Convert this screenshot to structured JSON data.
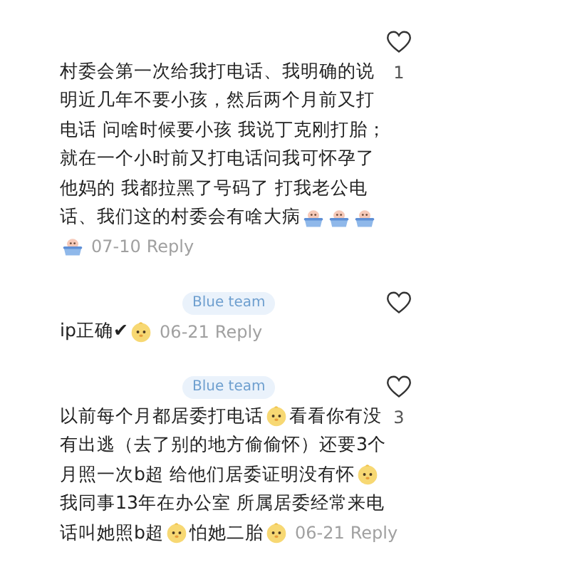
{
  "comments": [
    {
      "lines": [
        [
          {
            "kind": "text",
            "text": "村委会第一次给我打电话、我明确的说"
          }
        ],
        [
          {
            "kind": "text",
            "text": "明近几年不要小孩，然后两个月前又打"
          }
        ],
        [
          {
            "kind": "text",
            "text": "电话 问啥时候要小孩 我说丁克刚打胎；"
          }
        ],
        [
          {
            "kind": "text",
            "text": "就在一个小时前又打电话问我可怀孕了"
          }
        ],
        [
          {
            "kind": "text",
            "text": "他妈的 我都拉黑了号码了 打我老公电"
          }
        ],
        [
          {
            "kind": "text",
            "text": "话、我们这的村委会有啥大病"
          },
          {
            "kind": "tub"
          },
          {
            "kind": "tub"
          },
          {
            "kind": "tub"
          }
        ],
        [
          {
            "kind": "tub"
          }
        ]
      ],
      "date": "07-10",
      "reply": "Reply",
      "likes": "1"
    },
    {
      "tag": "Blue team",
      "lines": [
        [
          {
            "kind": "text",
            "text": "ip正确✔"
          },
          {
            "kind": "chick"
          }
        ]
      ],
      "date": "06-21",
      "reply": "Reply"
    },
    {
      "tag": "Blue team",
      "lines": [
        [
          {
            "kind": "text",
            "text": "以前每个月都居委打电话"
          },
          {
            "kind": "chick"
          },
          {
            "kind": "text",
            "text": "看看你有没"
          }
        ],
        [
          {
            "kind": "text",
            "text": "有出逃（去了别的地方偷偷怀）还要3个"
          }
        ],
        [
          {
            "kind": "text",
            "text": "月照一次b超 给他们居委证明没有怀"
          },
          {
            "kind": "chick"
          }
        ],
        [
          {
            "kind": "text",
            "text": "我同事13年在办公室 所属居委经常来电"
          }
        ],
        [
          {
            "kind": "text",
            "text": "话叫她照b超"
          },
          {
            "kind": "chick"
          },
          {
            "kind": "text",
            "text": "怕她二胎"
          },
          {
            "kind": "chick"
          }
        ]
      ],
      "date": "06-21",
      "reply": "Reply",
      "likes": "3"
    }
  ]
}
